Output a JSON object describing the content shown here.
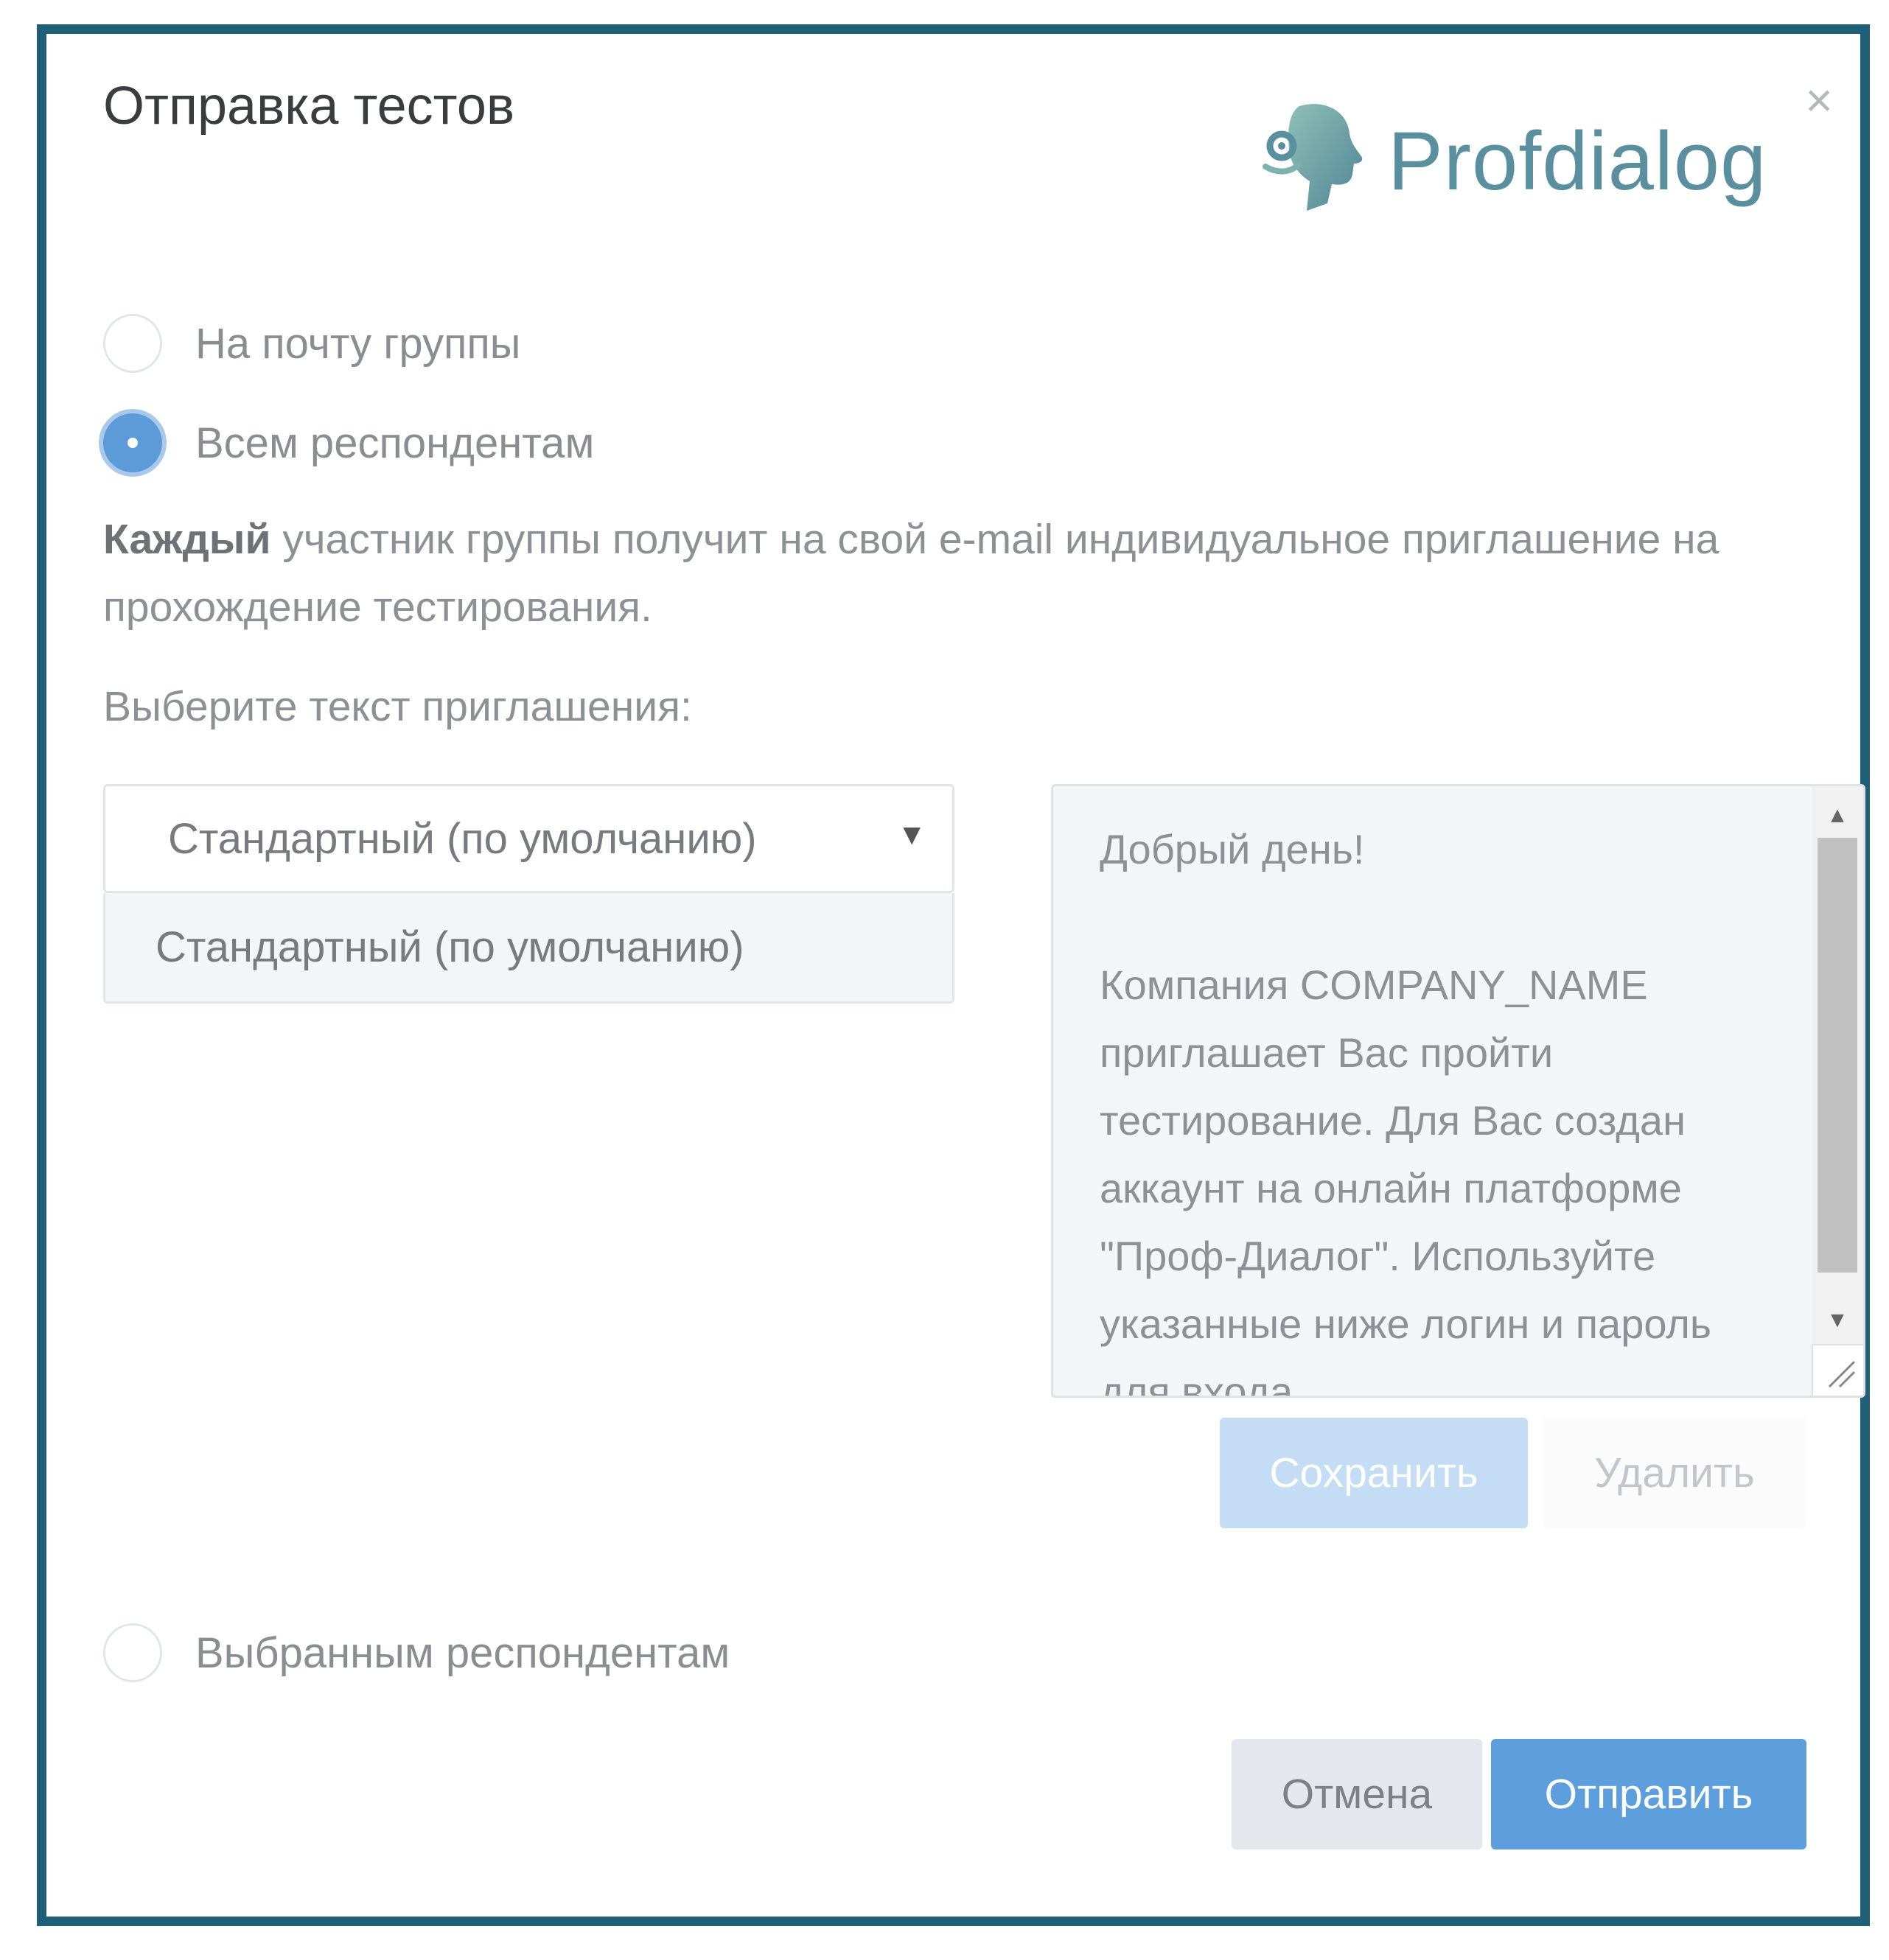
{
  "dialog": {
    "title": "Отправка тестов",
    "close_glyph": "×",
    "logo_text": "Profdialog",
    "logo_icon": "profile-head-icon"
  },
  "options": [
    {
      "label": "На почту группы",
      "checked": false
    },
    {
      "label": "Всем респондентам",
      "checked": true
    },
    {
      "label": "Выбранным респондентам",
      "checked": false
    }
  ],
  "description": {
    "bold": "Каждый",
    "rest": " участник группы получит на свой e-mail индивидуальное приглашение на прохождение тестирования."
  },
  "invitation": {
    "label": "Выберите текст приглашения:",
    "selected": "Стандартный (по умолчанию)",
    "dropdown_options": [
      "Стандартный (по умолчанию)"
    ],
    "text": "Добрый день!\n\nКомпания COMPANY_NAME приглашает Вас пройти тестирование. Для Вас создан аккаунт на онлайн платформе \"Проф-Диалог\". Используйте указанные ниже логин и пароль для входа."
  },
  "buttons": {
    "save": "Сохранить",
    "delete": "Удалить",
    "cancel": "Отмена",
    "send": "Отправить"
  },
  "colors": {
    "frame_border": "#1f6078",
    "accent": "#5d9fdd",
    "logo": "#5a8f9f"
  }
}
